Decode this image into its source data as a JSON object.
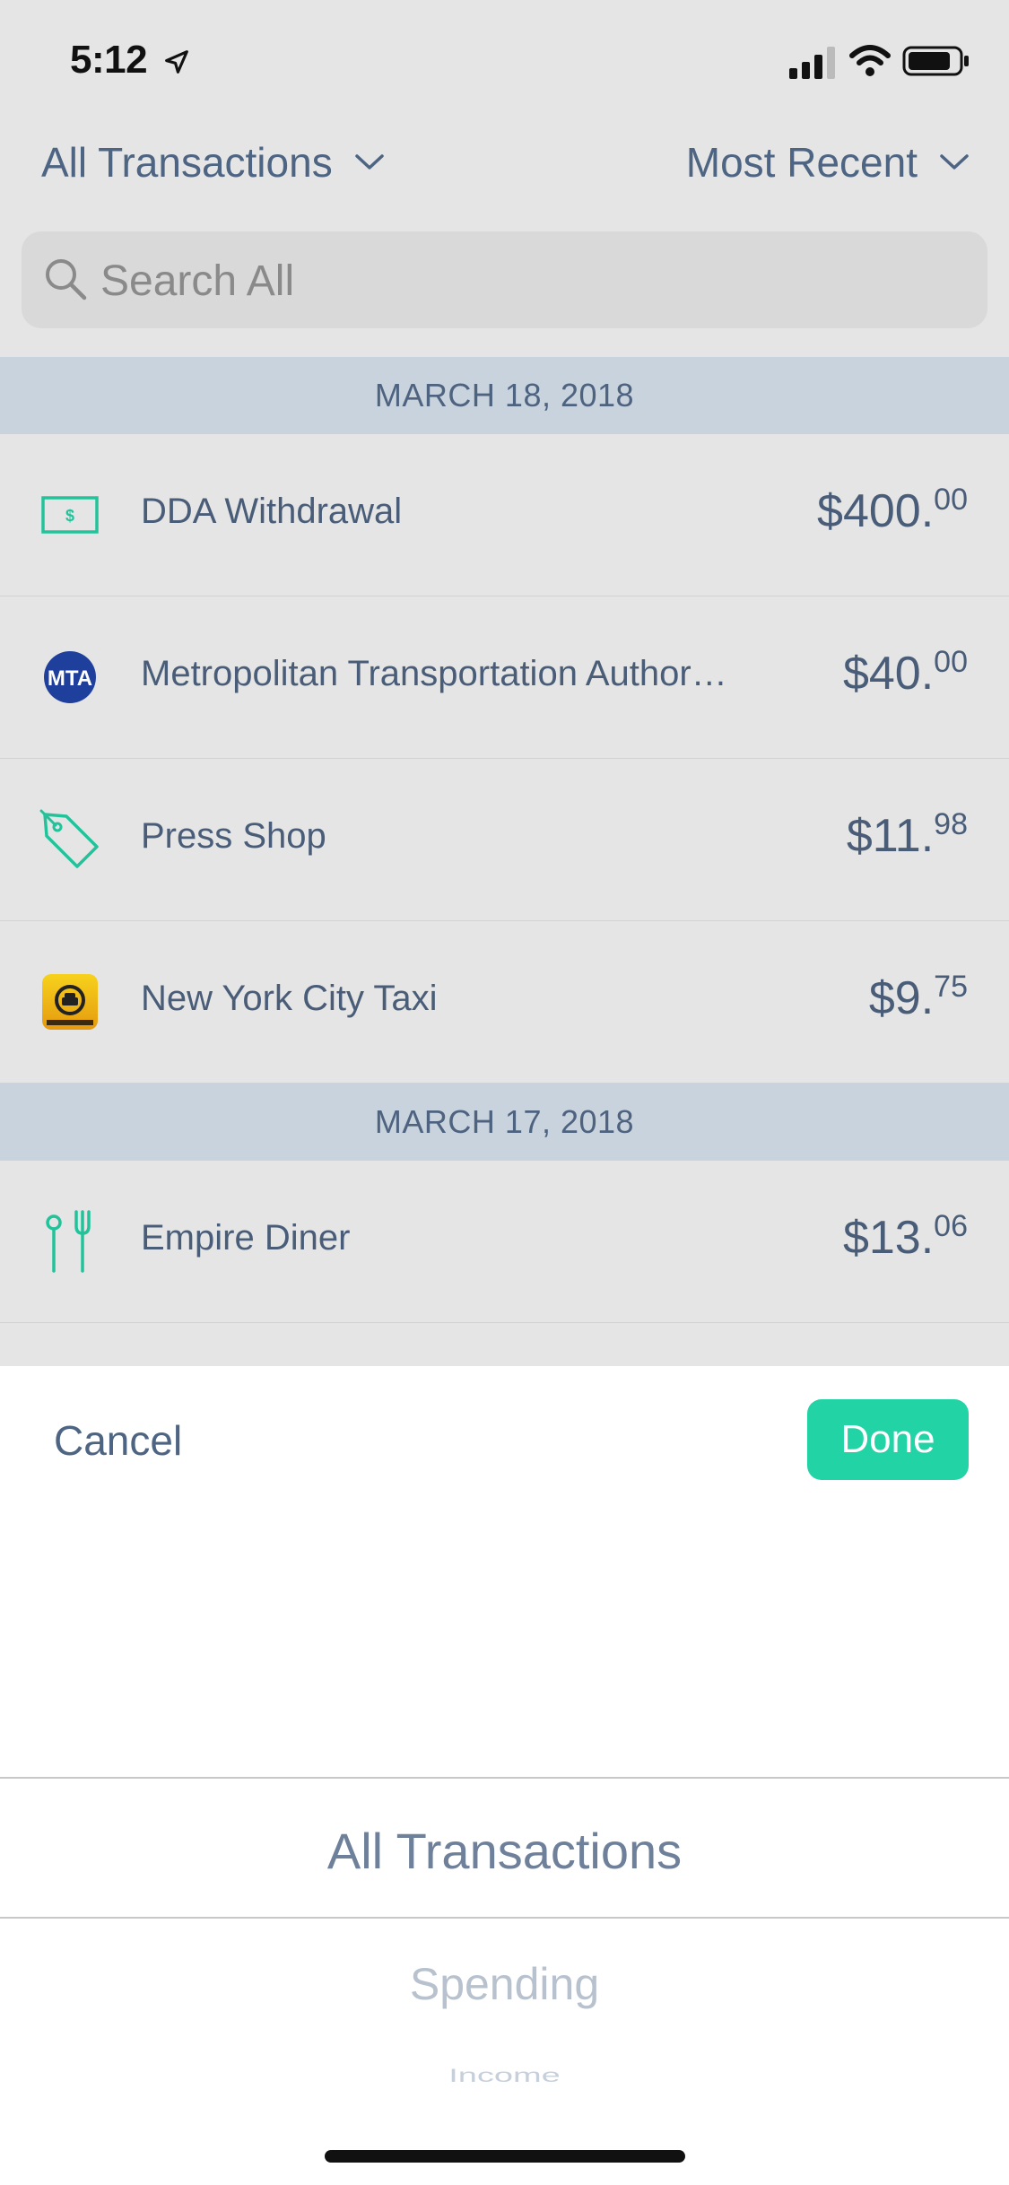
{
  "status_bar": {
    "time": "5:12"
  },
  "header": {
    "filter_label": "All Transactions",
    "sort_label": "Most Recent"
  },
  "search": {
    "placeholder": "Search All"
  },
  "sections": [
    {
      "date": "MARCH 18, 2018",
      "transactions": [
        {
          "name": "DDA Withdrawal",
          "dollars": "$400.",
          "cents": "00",
          "icon": "cash-icon"
        },
        {
          "name": "Metropolitan Transportation Author…",
          "dollars": "$40.",
          "cents": "00",
          "icon": "mta-logo-icon"
        },
        {
          "name": "Press Shop",
          "dollars": "$11.",
          "cents": "98",
          "icon": "tag-icon"
        },
        {
          "name": "New York City Taxi",
          "dollars": "$9.",
          "cents": "75",
          "icon": "taxi-app-icon"
        }
      ]
    },
    {
      "date": "MARCH 17, 2018",
      "transactions": [
        {
          "name": "Empire Diner",
          "dollars": "$13.",
          "cents": "06",
          "icon": "fork-knife-icon"
        }
      ]
    }
  ],
  "sheet": {
    "cancel_label": "Cancel",
    "done_label": "Done",
    "picker_options": [
      "All Transactions",
      "Spending",
      "Income"
    ],
    "selected_option": "All Transactions"
  },
  "colors": {
    "accent": "#22d3a6",
    "text": "#4a5d78",
    "section_header_bg": "#c9d3dd",
    "background": "#e5e5e5"
  }
}
